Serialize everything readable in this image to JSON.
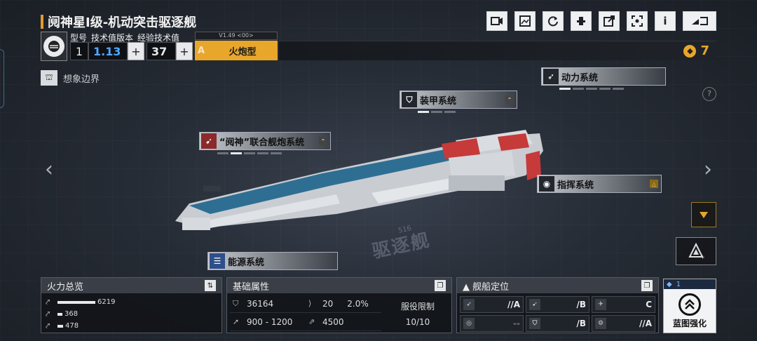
{
  "header": {
    "title": "阋神星I级-机动突击驱逐舰",
    "toolbar": [
      "video-icon",
      "image-icon",
      "refresh-icon",
      "hydrant-icon",
      "share-icon",
      "scan-icon",
      "info-icon",
      "back-icon"
    ]
  },
  "spec": {
    "labels": [
      "型号",
      "技术值版本",
      "经验技术值"
    ],
    "model": "1",
    "tech_version": "1.13",
    "exp_value": "37",
    "version_tag": "V1.49 <00>",
    "type_grade": "A",
    "type_name": "火炮型",
    "currency": "7"
  },
  "imagine": {
    "label": "想象边界"
  },
  "systems": {
    "power": "动力系统",
    "armor": "装甲系统",
    "cannon": "“阋神”联合舰炮系统",
    "command": "指挥系统",
    "energy": "能源系统"
  },
  "watermark": {
    "text": "驱逐舰",
    "number": "516"
  },
  "firepower": {
    "title": "火力总览",
    "rows": [
      {
        "value": "6219",
        "fraction": 0.9
      },
      {
        "value": "368",
        "fraction": 0.12
      },
      {
        "value": "478",
        "fraction": 0.14
      }
    ]
  },
  "base": {
    "title": "基础属性",
    "hp": "36164",
    "armor": "20",
    "evasion": "2.0%",
    "speed": "900 - 1200",
    "energy": "4500",
    "service_label": "服役限制",
    "service_value": "10/10"
  },
  "positioning": {
    "title": "舰船定位",
    "cells": [
      {
        "grade": "//A"
      },
      {
        "grade": "/B"
      },
      {
        "grade": "C"
      },
      {
        "grade": "--"
      },
      {
        "grade": "/B"
      },
      {
        "grade": "//A"
      }
    ]
  },
  "blueprint": {
    "count": "1",
    "label": "蓝图强化"
  },
  "colors": {
    "accent": "#e8a62a",
    "panel": "#3a3f47",
    "blue": "#52a7ff"
  }
}
